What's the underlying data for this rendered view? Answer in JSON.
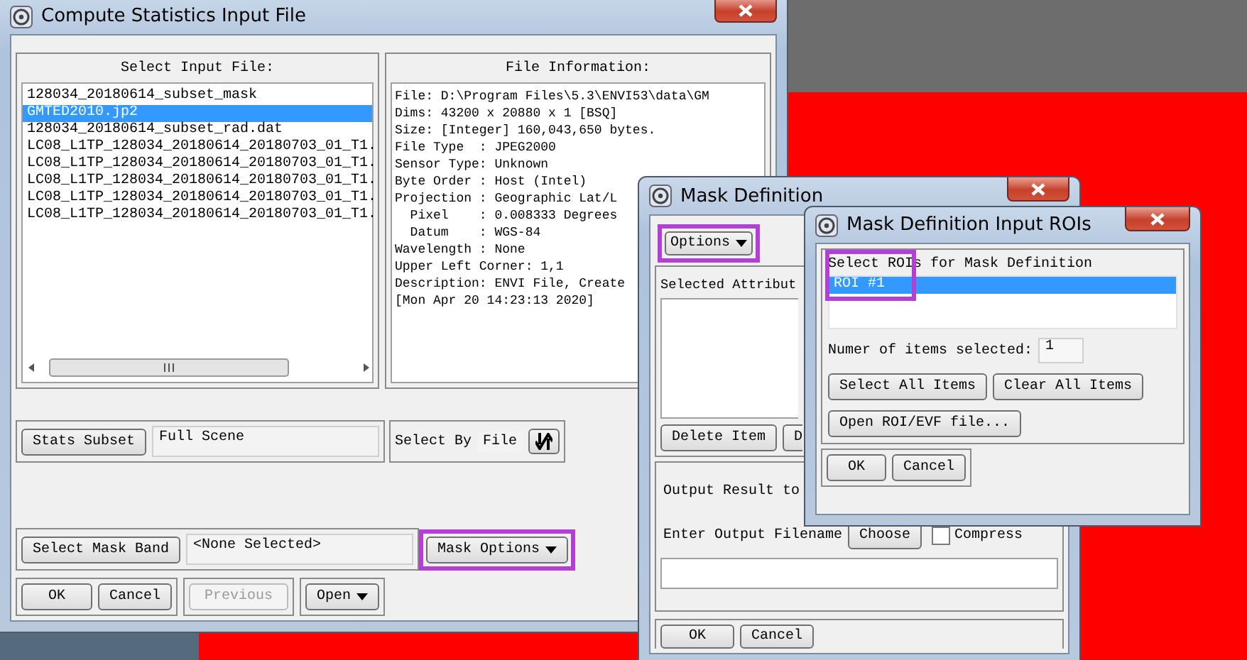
{
  "main_window": {
    "title": "Compute Statistics Input File",
    "input_files": {
      "label": "Select Input File:",
      "items": [
        {
          "name": "128034_20180614_subset_mask",
          "selected": false
        },
        {
          "name": "GMTED2010.jp2",
          "selected": true
        },
        {
          "name": "128034_20180614_subset_rad.dat",
          "selected": false
        },
        {
          "name": "LC08_L1TP_128034_20180614_20180703_01_T1.",
          "selected": false
        },
        {
          "name": "LC08_L1TP_128034_20180614_20180703_01_T1.",
          "selected": false
        },
        {
          "name": "LC08_L1TP_128034_20180614_20180703_01_T1.",
          "selected": false
        },
        {
          "name": "LC08_L1TP_128034_20180614_20180703_01_T1.",
          "selected": false
        },
        {
          "name": "LC08_L1TP_128034_20180614_20180703_01_T1.",
          "selected": false
        }
      ]
    },
    "file_info": {
      "label": "File Information:",
      "lines": [
        "File: D:\\Program Files\\5.3\\ENVI53\\data\\GM",
        "Dims: 43200 x 20880 x 1 [BSQ]",
        "Size: [Integer] 160,043,650 bytes.",
        "File Type  : JPEG2000",
        "Sensor Type: Unknown",
        "Byte Order : Host (Intel)",
        "Projection : Geographic Lat/L",
        "  Pixel    : 0.008333 Degrees",
        "  Datum    : WGS-84",
        "Wavelength : None",
        "Upper Left Corner: 1,1",
        "Description: ENVI File, Create",
        "[Mon Apr 20 14:23:13 2020]"
      ]
    },
    "stats_subset": {
      "button": "Stats Subset",
      "value": "Full Scene"
    },
    "select_by": {
      "label": "Select By",
      "value": "File"
    },
    "mask_band": {
      "button": "Select Mask Band",
      "value": "<None Selected>"
    },
    "mask_options": {
      "label": "Mask Options",
      "highlighted": true
    },
    "dialog_buttons": [
      {
        "label": "OK",
        "disabled": false
      },
      {
        "label": "Cancel",
        "disabled": false
      }
    ],
    "previous_button": {
      "label": "Previous",
      "disabled": true
    },
    "open_button": {
      "label": "Open"
    }
  },
  "mask_definition": {
    "title": "Mask Definition",
    "options": {
      "label": "Options",
      "highlighted": true
    },
    "attributes_label": "Selected Attribut",
    "item_buttons": [
      "Delete Item",
      "D"
    ],
    "output_label": "Output Result to",
    "filename_label": "Enter Output Filename",
    "choose_button": "Choose",
    "compress": {
      "label": "Compress",
      "checked": false
    },
    "buttons": [
      "OK",
      "Cancel"
    ]
  },
  "input_rois": {
    "title": "Mask Definition Input ROIs",
    "label": "Select ROIs for Mask Definition",
    "highlighted": true,
    "items": [
      {
        "name": "ROI #1",
        "selected": true
      }
    ],
    "count_label": "Numer of items selected:",
    "count": "1",
    "buttons": [
      "Select All Items",
      "Clear All Items"
    ],
    "open_button": "Open ROI/EVF file...",
    "dialog_buttons": [
      "OK",
      "Cancel"
    ]
  }
}
